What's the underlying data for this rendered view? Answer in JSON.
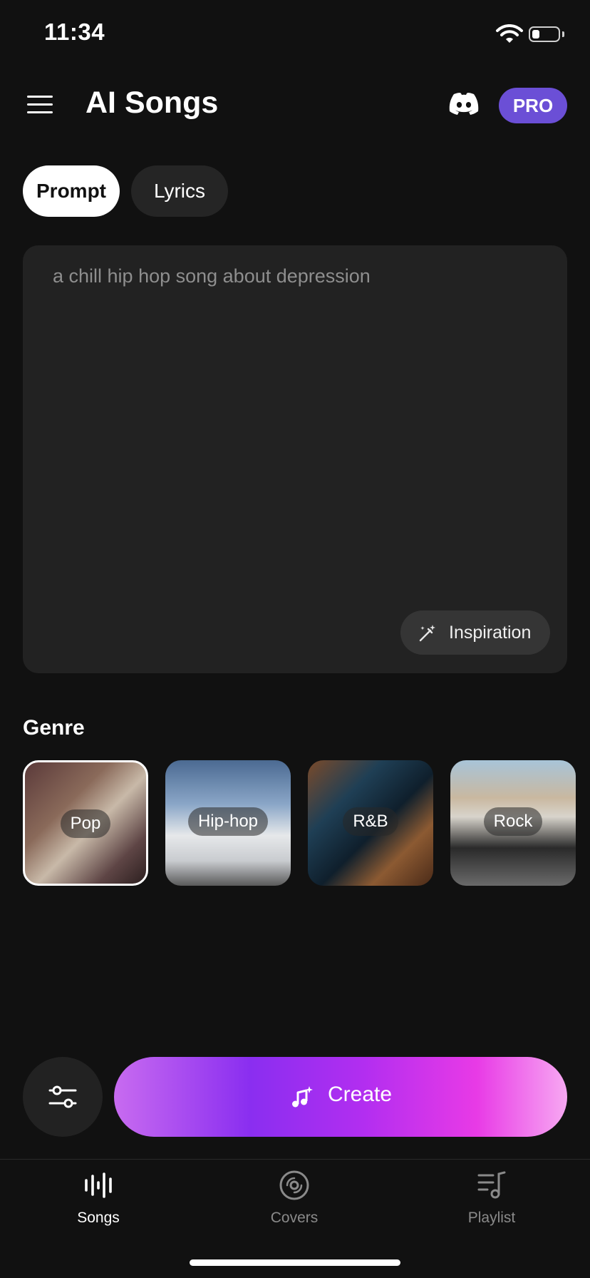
{
  "status_bar": {
    "time": "11:34",
    "battery_level": 0.25
  },
  "header": {
    "title": "AI Songs",
    "menu_icon": "hamburger-menu-icon",
    "discord_icon": "discord-icon",
    "pro_label": "PRO"
  },
  "tabs": [
    {
      "label": "Prompt",
      "selected": true
    },
    {
      "label": "Lyrics",
      "selected": false
    }
  ],
  "prompt": {
    "placeholder": "a chill hip hop song about depression",
    "inspiration_label": "Inspiration",
    "inspiration_icon": "magic-wand-icon"
  },
  "genre": {
    "title": "Genre",
    "items": [
      {
        "label": "Pop",
        "selected": true
      },
      {
        "label": "Hip-hop",
        "selected": false
      },
      {
        "label": "R&B",
        "selected": false
      },
      {
        "label": "Rock",
        "selected": false
      }
    ]
  },
  "actions": {
    "settings_icon": "sliders-icon",
    "create_label": "Create",
    "create_icon": "sparkle-music-note-icon"
  },
  "bottom_nav": [
    {
      "label": "Songs",
      "icon": "waveform-icon",
      "active": true
    },
    {
      "label": "Covers",
      "icon": "disc-icon",
      "active": false
    },
    {
      "label": "Playlist",
      "icon": "playlist-icon",
      "active": false
    }
  ],
  "colors": {
    "background": "#111111",
    "card": "#222222",
    "pro_badge": "#6b4fd6",
    "create_gradient_start": "#c86bf0",
    "create_gradient_end": "#f7a8f2"
  }
}
